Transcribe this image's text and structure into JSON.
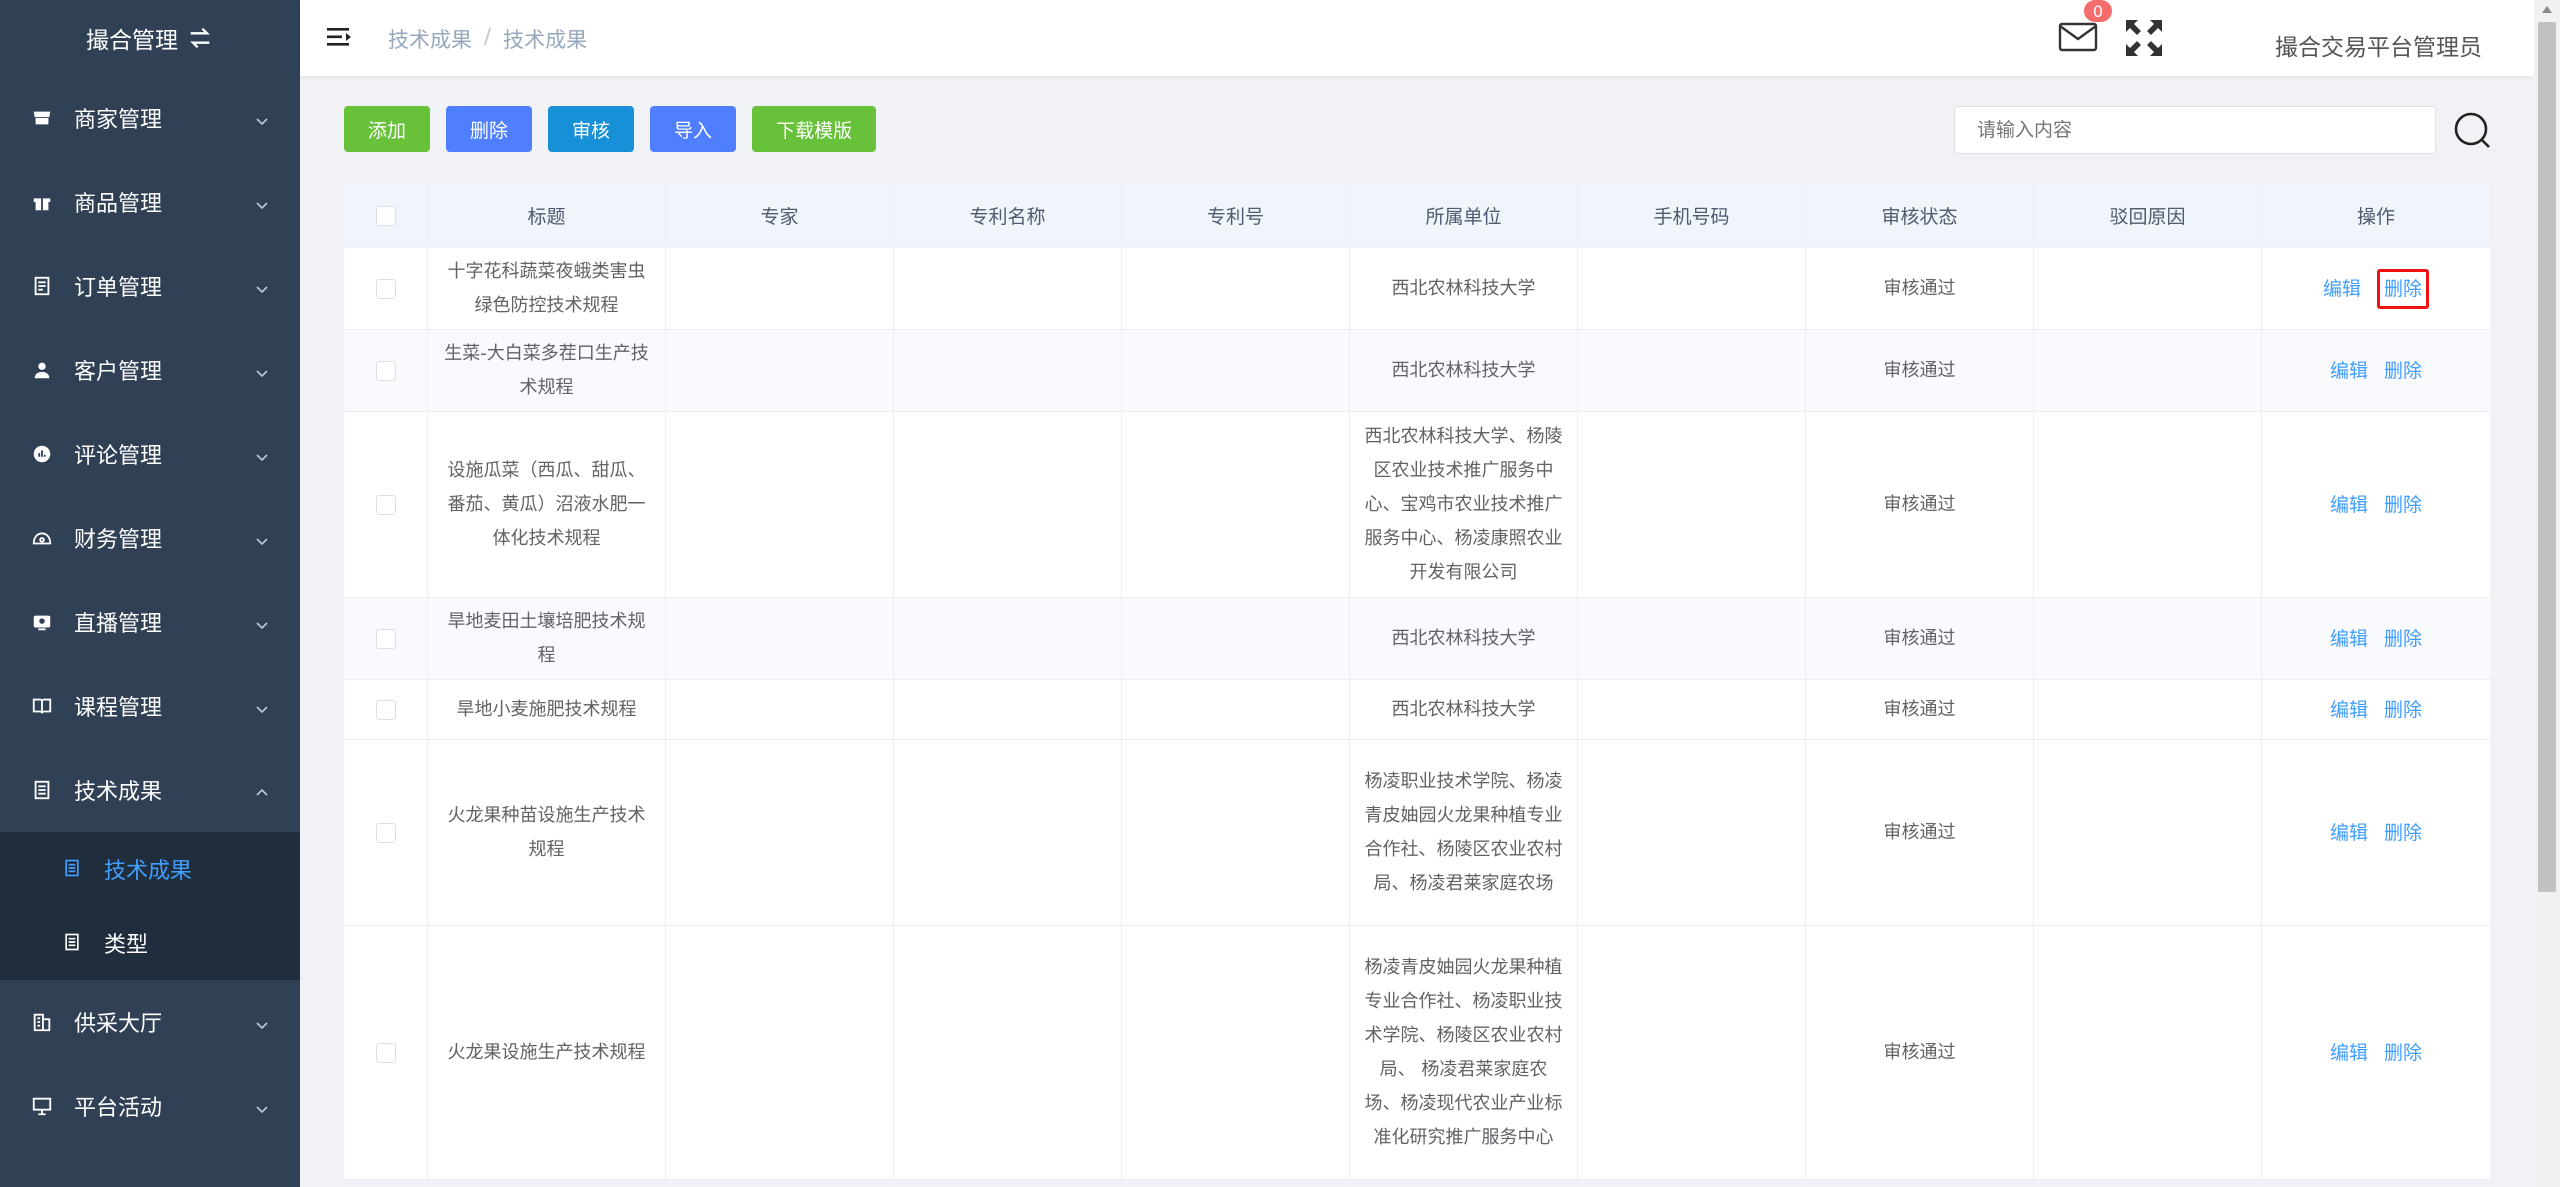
{
  "sidebar": {
    "brand": "撮合管理",
    "items": [
      {
        "label": "商家管理",
        "icon": "store-icon"
      },
      {
        "label": "商品管理",
        "icon": "gift-icon"
      },
      {
        "label": "订单管理",
        "icon": "order-icon"
      },
      {
        "label": "客户管理",
        "icon": "user-icon"
      },
      {
        "label": "评论管理",
        "icon": "comment-icon"
      },
      {
        "label": "财务管理",
        "icon": "finance-icon"
      },
      {
        "label": "直播管理",
        "icon": "live-icon"
      },
      {
        "label": "课程管理",
        "icon": "book-icon"
      },
      {
        "label": "技术成果",
        "icon": "document-icon",
        "expanded": true
      },
      {
        "label": "供采大厅",
        "icon": "building-icon"
      },
      {
        "label": "平台活动",
        "icon": "monitor-icon"
      }
    ],
    "submenu": [
      {
        "label": "技术成果",
        "active": true
      },
      {
        "label": "类型",
        "active": false
      }
    ]
  },
  "header": {
    "breadcrumb": [
      "技术成果",
      "技术成果"
    ],
    "mail_count": "0",
    "username": "撮合交易平台管理员"
  },
  "toolbar": {
    "add": "添加",
    "delete": "删除",
    "audit": "审核",
    "import": "导入",
    "download_template": "下载模版"
  },
  "search": {
    "placeholder": "请输入内容"
  },
  "table": {
    "columns": [
      "标题",
      "专家",
      "专利名称",
      "专利号",
      "所属单位",
      "手机号码",
      "审核状态",
      "驳回原因",
      "操作"
    ],
    "edit_label": "编辑",
    "delete_label": "删除",
    "rows": [
      {
        "title": "十字花科蔬菜夜蛾类害虫绿色防控技术规程",
        "expert": "",
        "patent_name": "",
        "patent_no": "",
        "unit": "西北农林科技大学",
        "phone": "",
        "status": "审核通过",
        "reason": ""
      },
      {
        "title": "生菜-大白菜多茬口生产技术规程",
        "expert": "",
        "patent_name": "",
        "patent_no": "",
        "unit": "西北农林科技大学",
        "phone": "",
        "status": "审核通过",
        "reason": ""
      },
      {
        "title": "设施瓜菜（西瓜、甜瓜、番茄、黄瓜）沼液水肥一体化技术规程",
        "expert": "",
        "patent_name": "",
        "patent_no": "",
        "unit": "西北农林科技大学、杨陵区农业技术推广服务中心、宝鸡市农业技术推广服务中心、杨凌康照农业开发有限公司",
        "phone": "",
        "status": "审核通过",
        "reason": ""
      },
      {
        "title": "旱地麦田土壤培肥技术规程",
        "expert": "",
        "patent_name": "",
        "patent_no": "",
        "unit": "西北农林科技大学",
        "phone": "",
        "status": "审核通过",
        "reason": ""
      },
      {
        "title": "旱地小麦施肥技术规程",
        "expert": "",
        "patent_name": "",
        "patent_no": "",
        "unit": "西北农林科技大学",
        "phone": "",
        "status": "审核通过",
        "reason": ""
      },
      {
        "title": "火龙果种苗设施生产技术规程",
        "expert": "",
        "patent_name": "",
        "patent_no": "",
        "unit": "杨凌职业技术学院、杨凌青皮妯园火龙果种植专业合作社、杨陵区农业农村局、杨凌君莱家庭农场",
        "phone": "",
        "status": "审核通过",
        "reason": ""
      },
      {
        "title": "火龙果设施生产技术规程",
        "expert": "",
        "patent_name": "",
        "patent_no": "",
        "unit": "杨凌青皮妯园火龙果种植专业合作社、杨凌职业技术学院、杨陵区农业农村局、 杨凌君莱家庭农场、杨凌现代农业产业标准化研究推广服务中心",
        "phone": "",
        "status": "审核通过",
        "reason": ""
      }
    ]
  }
}
